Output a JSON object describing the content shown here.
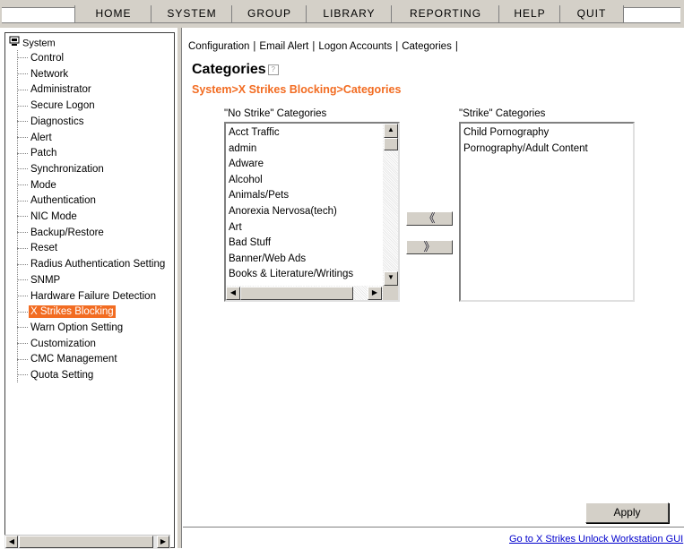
{
  "menu": {
    "items": [
      {
        "label": "HOME"
      },
      {
        "label": "SYSTEM"
      },
      {
        "label": "GROUP"
      },
      {
        "label": "LIBRARY"
      },
      {
        "label": "REPORTING"
      },
      {
        "label": "HELP"
      },
      {
        "label": "QUIT"
      }
    ]
  },
  "tree": {
    "root_label": "System",
    "selected": "X Strikes Blocking",
    "items": [
      {
        "label": "Control"
      },
      {
        "label": "Network"
      },
      {
        "label": "Administrator"
      },
      {
        "label": "Secure Logon"
      },
      {
        "label": "Diagnostics"
      },
      {
        "label": "Alert"
      },
      {
        "label": "Patch"
      },
      {
        "label": "Synchronization"
      },
      {
        "label": "Mode"
      },
      {
        "label": "Authentication"
      },
      {
        "label": "NIC Mode"
      },
      {
        "label": "Backup/Restore"
      },
      {
        "label": "Reset"
      },
      {
        "label": "Radius Authentication Setting"
      },
      {
        "label": "SNMP"
      },
      {
        "label": "Hardware Failure Detection"
      },
      {
        "label": "X Strikes Blocking"
      },
      {
        "label": "Warn Option Setting"
      },
      {
        "label": "Customization"
      },
      {
        "label": "CMC Management"
      },
      {
        "label": "Quota Setting"
      }
    ]
  },
  "tabs": [
    {
      "label": "Configuration"
    },
    {
      "label": "Email Alert"
    },
    {
      "label": "Logon Accounts"
    },
    {
      "label": "Categories"
    }
  ],
  "page": {
    "title": "Categories",
    "breadcrumb": "System>X Strikes Blocking>Categories"
  },
  "no_strike": {
    "label": "\"No Strike\" Categories",
    "items": [
      "Acct Traffic",
      "admin",
      "Adware",
      "Alcohol",
      "Animals/Pets",
      "Anorexia Nervosa(tech)",
      "Art",
      "Bad Stuff",
      "Banner/Web Ads",
      "Books & Literature/Writings"
    ]
  },
  "strike": {
    "label": "\"Strike\" Categories",
    "items": [
      "Child Pornography",
      "Pornography/Adult Content"
    ]
  },
  "buttons": {
    "move_left": "《",
    "move_right": "》",
    "apply": "Apply"
  },
  "footer": {
    "link": "Go to X Strikes Unlock Workstation GUI"
  },
  "colors": {
    "accent": "#f26c22",
    "link": "#0000cc",
    "chrome": "#d4d0c8"
  }
}
